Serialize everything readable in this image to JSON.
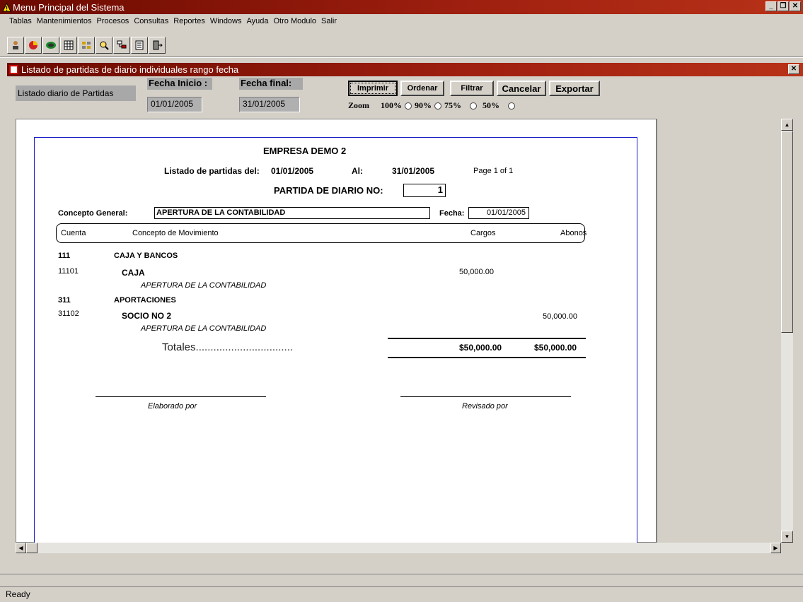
{
  "app": {
    "title": "Menu Principal del Sistema"
  },
  "menu": [
    "Tablas",
    "Mantenimientos",
    "Procesos",
    "Consultas",
    "Reportes",
    "Windows",
    "Ayuda",
    "Otro Modulo",
    "Salir"
  ],
  "window_buttons": {
    "minimize": "_",
    "restore": "❐",
    "close": "✕"
  },
  "toolbar_icons": [
    "user-search-icon",
    "pie-chart-icon",
    "globe-icon",
    "grid-icon",
    "table-icon",
    "magnifier-icon",
    "tree-icon",
    "document-icon",
    "exit-door-icon"
  ],
  "child": {
    "title": "Listado de partidas de diario individuales rango fecha",
    "close": "✕"
  },
  "form": {
    "report_label": "Listado diario de Partidas",
    "fecha_inicio_label": "Fecha Inicio :",
    "fecha_inicio_value": "01/01/2005",
    "fecha_final_label": "Fecha final:",
    "fecha_final_value": "31/01/2005",
    "buttons": {
      "imprimir": "Imprimir",
      "ordenar": "Ordenar",
      "filtrar": "Filtrar",
      "cancelar": "Cancelar",
      "exportar": "Exportar"
    },
    "zoom_label": "Zoom",
    "zoom_options": [
      "100%",
      "90%",
      "75%",
      "50%"
    ]
  },
  "report": {
    "company": "EMPRESA DEMO 2",
    "listado_label": "Listado de partidas del:",
    "date_from": "01/01/2005",
    "al_label": "Al:",
    "date_to": "31/01/2005",
    "page": "Page 1 of 1",
    "partida_label": "PARTIDA DE DIARIO NO:",
    "partida_no": "1",
    "concepto_label": "Concepto General:",
    "concepto_value": "APERTURA DE LA CONTABILIDAD",
    "fecha_label": "Fecha:",
    "fecha_value": "01/01/2005",
    "columns": {
      "cuenta": "Cuenta",
      "concepto": "Concepto de Movimiento",
      "cargos": "Cargos",
      "abonos": "Abonos"
    },
    "rows": [
      {
        "code": "111",
        "name": "CAJA Y BANCOS"
      },
      {
        "code": "11101",
        "name": "CAJA",
        "desc": "APERTURA DE LA CONTABILIDAD",
        "cargo": "50,000.00"
      },
      {
        "code": "311",
        "name": "APORTACIONES"
      },
      {
        "code": "31102",
        "name": "SOCIO NO 2",
        "desc": "APERTURA DE LA CONTABILIDAD",
        "abono": "50,000.00"
      }
    ],
    "totales_label": "Totales.................................",
    "total_cargos": "$50,000.00",
    "total_abonos": "$50,000.00",
    "elaborado": "Elaborado por",
    "revisado": "Revisado por"
  },
  "status": "Ready"
}
